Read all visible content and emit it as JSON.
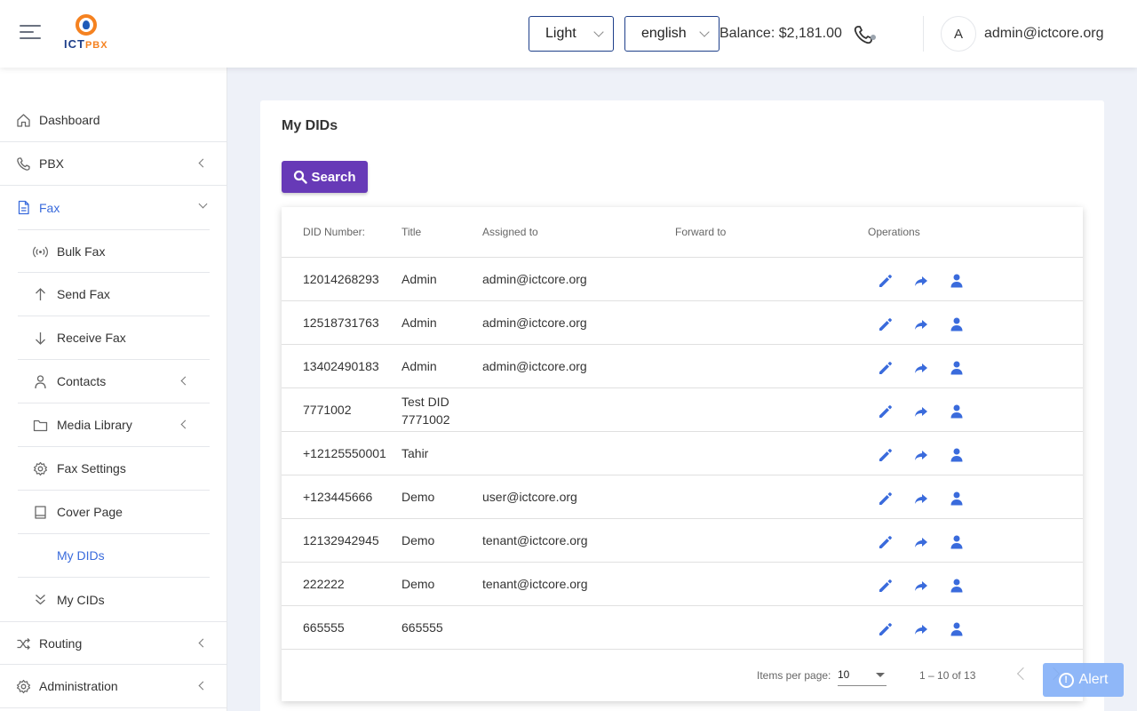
{
  "header": {
    "logo_text_a": "ICT",
    "logo_text_b": "PBX",
    "theme_value": "Light",
    "language_value": "english",
    "balance": "Balance: $2,181.00",
    "avatar_letter": "A",
    "user_email": "admin@ictcore.org"
  },
  "sidebar": {
    "items": [
      {
        "label": "Dashboard",
        "icon": "home-icon"
      },
      {
        "label": "PBX",
        "icon": "phone-icon"
      },
      {
        "label": "Fax",
        "icon": "document-icon"
      },
      {
        "label": "Bulk Fax",
        "icon": "broadcast-icon"
      },
      {
        "label": "Send Fax",
        "icon": "arrow-up-icon"
      },
      {
        "label": "Receive Fax",
        "icon": "arrow-down-icon"
      },
      {
        "label": "Contacts",
        "icon": "person-icon"
      },
      {
        "label": "Media Library",
        "icon": "folder-icon"
      },
      {
        "label": "Fax Settings",
        "icon": "gear-icon"
      },
      {
        "label": "Cover Page",
        "icon": "book-icon"
      },
      {
        "label": "My DIDs",
        "icon": ""
      },
      {
        "label": "My CIDs",
        "icon": "double-chevron-down-icon"
      },
      {
        "label": "Routing",
        "icon": "shuffle-icon"
      },
      {
        "label": "Administration",
        "icon": "gear-icon"
      }
    ]
  },
  "main": {
    "title": "My DIDs",
    "search_label": "Search",
    "table": {
      "headers": [
        "DID Number:",
        "Title",
        "Assigned to",
        "Forward to",
        "Operations"
      ],
      "rows": [
        {
          "number": "12014268293",
          "title": "Admin",
          "assigned": "admin@ictcore.org",
          "forward": ""
        },
        {
          "number": "12518731763",
          "title": "Admin",
          "assigned": "admin@ictcore.org",
          "forward": ""
        },
        {
          "number": "13402490183",
          "title": "Admin",
          "assigned": "admin@ictcore.org",
          "forward": ""
        },
        {
          "number": "7771002",
          "title": "Test DID 7771002",
          "assigned": "",
          "forward": ""
        },
        {
          "number": "+12125550001",
          "title": "Tahir",
          "assigned": "",
          "forward": ""
        },
        {
          "number": "+123445666",
          "title": "Demo",
          "assigned": "user@ictcore.org",
          "forward": ""
        },
        {
          "number": "12132942945",
          "title": "Demo",
          "assigned": "tenant@ictcore.org",
          "forward": ""
        },
        {
          "number": "222222",
          "title": "Demo",
          "assigned": "tenant@ictcore.org",
          "forward": ""
        },
        {
          "number": "665555",
          "title": "665555",
          "assigned": "",
          "forward": ""
        }
      ]
    },
    "paginator": {
      "items_per_page_label": "Items per page:",
      "items_per_page_value": "10",
      "range": "1 – 10 of 13"
    }
  },
  "alert": {
    "label": "Alert"
  },
  "colors": {
    "accent": "#673ab7",
    "icon_blue": "#3a6bdc",
    "active_text": "#3a6bdc"
  }
}
